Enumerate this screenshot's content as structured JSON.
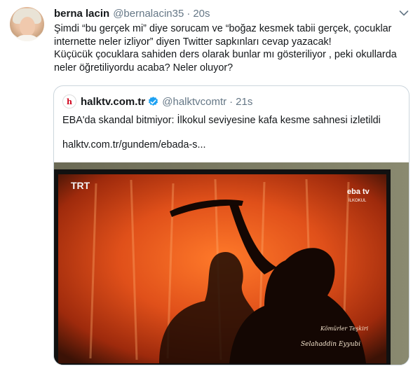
{
  "author": {
    "name": "berna lacin",
    "handle": "@bernalacin35",
    "separator": "·",
    "time": "20s"
  },
  "tweet_text": [
    "Şimdi “bu gerçek mi” diye sorucam ve “boğaz kesmek tabii gerçek, çocuklar internette neler izliyor” diyen Twitter sapkınları cevap yazacak!",
    "Küçücük çocuklara sahiden ders olarak bunlar mı gösteriliyor , peki okullarda neler öğretiliyordu acaba? Neler oluyor?"
  ],
  "quoted": {
    "logo_letter": "h",
    "name": "halktv.com.tr",
    "handle": "@halktvcomtr",
    "separator": "·",
    "time": "21s",
    "text": "EBA'da skandal bitmiyor: İlkokul seviyesine kafa kesme sahnesi izletildi",
    "link": "halktv.com.tr/gundem/ebada-s..."
  },
  "media": {
    "channel_logo": "TRT",
    "corner_logo": "eba tv",
    "corner_sub": "İLKOKUL",
    "caption_line1": "Kömürler Teşkiri",
    "caption_line2": "Selahaddin Eyyubi"
  },
  "colors": {
    "text": "#14171a",
    "muted": "#657786",
    "border": "#ccd6dd",
    "verified": "#1da1f2",
    "fire": "#e0501a"
  },
  "icons": {
    "menu": "chevron-down-icon",
    "verified": "verified-badge-icon"
  }
}
